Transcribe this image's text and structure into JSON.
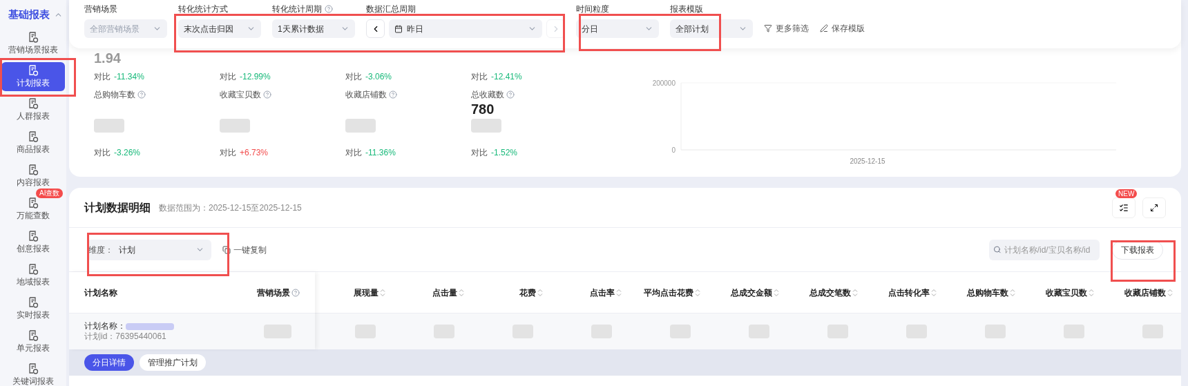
{
  "sidebar": {
    "section": {
      "title": "基础报表",
      "expanded": true
    },
    "items": [
      {
        "label": "营销场景报表",
        "selected": false
      },
      {
        "label": "计划报表",
        "selected": true
      },
      {
        "label": "人群报表",
        "selected": false
      },
      {
        "label": "商品报表",
        "selected": false
      },
      {
        "label": "内容报表",
        "selected": false
      },
      {
        "label": "万能查数",
        "selected": false,
        "badge": "AI查数"
      },
      {
        "label": "创意报表",
        "selected": false
      },
      {
        "label": "地域报表",
        "selected": false
      },
      {
        "label": "实时报表",
        "selected": false
      },
      {
        "label": "单元报表",
        "selected": false
      },
      {
        "label": "关键词报表",
        "selected": false
      }
    ]
  },
  "filters": [
    {
      "kind": "select",
      "label": "营销场景",
      "value": "全部营销场景",
      "disabled": true
    },
    {
      "kind": "select",
      "label": "转化统计方式",
      "value": "末次点击归因",
      "disabled": false
    },
    {
      "kind": "select",
      "label": "转化统计周期",
      "value": "1天累计数据",
      "disabled": false,
      "help": true
    },
    {
      "kind": "date",
      "label": "数据汇总周期",
      "value": "昨日",
      "disabled": false
    },
    {
      "kind": "select",
      "label": "时间粒度",
      "value": "分日",
      "disabled": false
    },
    {
      "kind": "select",
      "label": "报表模版",
      "value": "全部计划",
      "disabled": false
    }
  ],
  "filter_actions": [
    {
      "kind": "filter",
      "label": "更多筛选"
    },
    {
      "kind": "edit",
      "label": "保存模版"
    }
  ],
  "metrics_top": [
    {
      "value": "1.94",
      "compare_label": "对比",
      "compare": "-11.34%",
      "color": "#18b97a"
    },
    {
      "compare_label": "对比",
      "compare": "-12.99%",
      "color": "#18b97a"
    },
    {
      "compare_label": "对比",
      "compare": "-3.06%",
      "color": "#18b97a"
    },
    {
      "compare_label": "对比",
      "compare": "-12.41%",
      "color": "#18b97a"
    }
  ],
  "metrics_bottom": [
    {
      "label": "总购物车数",
      "compare_label": "对比",
      "compare": "-3.26%",
      "color": "#18b97a"
    },
    {
      "label": "收藏宝贝数",
      "compare_label": "对比",
      "compare": "+6.73%",
      "color": "#f24c4c"
    },
    {
      "label": "收藏店铺数",
      "compare_label": "对比",
      "compare": "-11.36%",
      "color": "#18b97a"
    },
    {
      "label": "总收藏数",
      "value": "780",
      "compare_label": "对比",
      "compare": "-1.52%",
      "color": "#18b97a"
    }
  ],
  "chart_data": {
    "type": "line",
    "x": [
      "2025-12-15"
    ],
    "yticks": [
      0,
      200000
    ],
    "ylim": [
      0,
      200000
    ]
  },
  "detail": {
    "title": "计划数据明细",
    "range": "数据范围为：2025-12-15至2025-12-15",
    "new_badge": "NEW",
    "dimension": {
      "label": "维度：",
      "value": "计划"
    },
    "copy": "一键复制",
    "search": {
      "placeholder": "计划名称/id/宝贝名称/id"
    },
    "download": "下载报表"
  },
  "table": {
    "frozen_columns": [
      {
        "label": "计划名称"
      },
      {
        "label": "营销场景",
        "help": true
      }
    ],
    "columns": [
      {
        "label": "展现量"
      },
      {
        "label": "点击量"
      },
      {
        "label": "花费"
      },
      {
        "label": "点击率"
      },
      {
        "label": "平均点击花费"
      },
      {
        "label": "总成交金额"
      },
      {
        "label": "总成交笔数"
      },
      {
        "label": "点击转化率"
      },
      {
        "label": "总购物车数"
      },
      {
        "label": "收藏宝贝数"
      },
      {
        "label": "收藏店铺数"
      }
    ],
    "rows": [
      {
        "name_label": "计划名称：",
        "id_label": "计划id：76395440061"
      }
    ],
    "row_actions": [
      {
        "label": "分日详情",
        "selected": true
      },
      {
        "label": "管理推广计划",
        "selected": false
      }
    ]
  }
}
